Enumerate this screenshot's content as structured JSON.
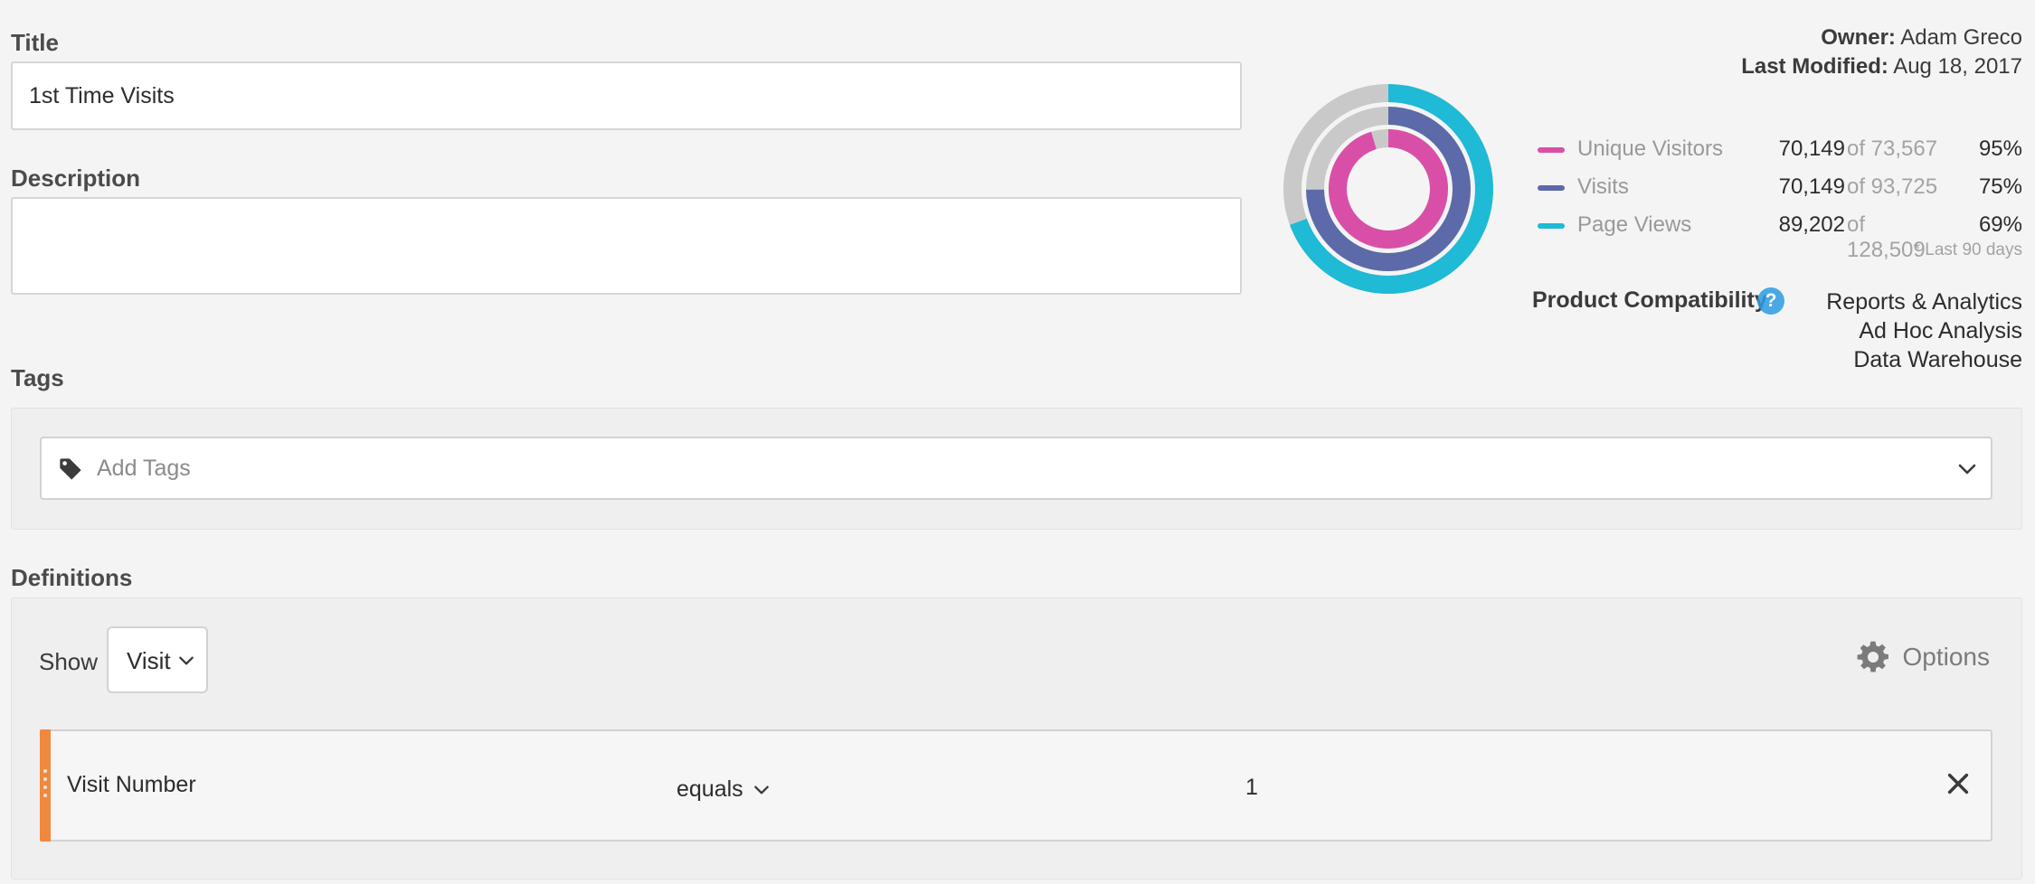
{
  "form": {
    "title_label": "Title",
    "title_value": "1st Time Visits",
    "description_label": "Description",
    "description_value": "",
    "tags_label": "Tags",
    "tags_placeholder": "Add Tags",
    "definitions_label": "Definitions"
  },
  "meta": {
    "owner_label": "Owner:",
    "owner_value": "Adam Greco",
    "modified_label": "Last Modified:",
    "modified_value": "Aug 18, 2017"
  },
  "chart_data": {
    "type": "pie",
    "variant": "nested-donut",
    "series": [
      {
        "name": "Unique Visitors",
        "value": 70149,
        "total": 73567,
        "percent": 95,
        "color": "#d94fa8"
      },
      {
        "name": "Visits",
        "value": 70149,
        "total": 93725,
        "percent": 75,
        "color": "#5c6aa9"
      },
      {
        "name": "Page Views",
        "value": 89202,
        "total": 128509,
        "percent": 69,
        "color": "#1ebad6"
      }
    ],
    "remainder_color": "#c9c9c9"
  },
  "legend": [
    {
      "name": "Unique Visitors",
      "value": "70,149",
      "of": "of 73,567",
      "pct": "95%"
    },
    {
      "name": "Visits",
      "value": "70,149",
      "of": "of 93,725",
      "pct": "75%"
    },
    {
      "name": "Page Views",
      "value": "89,202",
      "of": "of 128,509",
      "pct": "69%"
    }
  ],
  "footnote": "* Last 90 days",
  "compatibility": {
    "label": "Product Compatibility",
    "help_glyph": "?",
    "products": [
      "Reports & Analytics",
      "Ad Hoc Analysis",
      "Data Warehouse"
    ]
  },
  "definitions": {
    "show_label": "Show",
    "show_value": "Visit",
    "options_label": "Options",
    "rule": {
      "field": "Visit Number",
      "operator": "equals",
      "value": "1"
    }
  },
  "colors": {
    "accent_orange": "#f1883f",
    "help_blue": "#2d9de3"
  }
}
